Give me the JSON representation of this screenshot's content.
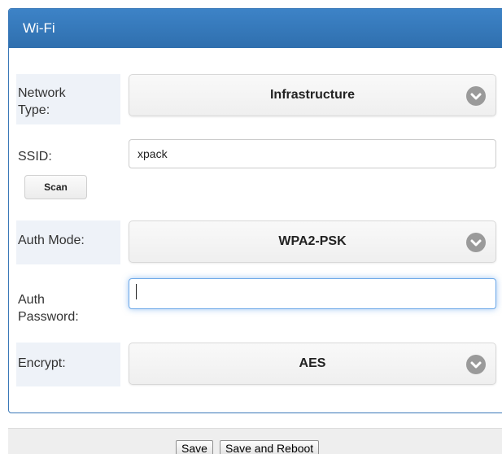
{
  "panel": {
    "title": "Wi-Fi"
  },
  "form": {
    "network_type": {
      "label": "Network\nType:",
      "value": "Infrastructure"
    },
    "ssid": {
      "label": "SSID:",
      "value": "xpack",
      "scan_label": "Scan"
    },
    "auth_mode": {
      "label": "Auth Mode:",
      "value": "WPA2-PSK"
    },
    "auth_password": {
      "label": "Auth\nPassword:",
      "value": ""
    },
    "encrypt": {
      "label": "Encrypt:",
      "value": "AES"
    }
  },
  "footer": {
    "save_label": "Save",
    "save_reboot_label": "Save and Reboot"
  },
  "icons": {
    "dropdown": "chevron-down-icon"
  },
  "colors": {
    "header": "#3d83c7",
    "label_background": "#eef2f8",
    "focus_glow": "#6aa7e8"
  }
}
